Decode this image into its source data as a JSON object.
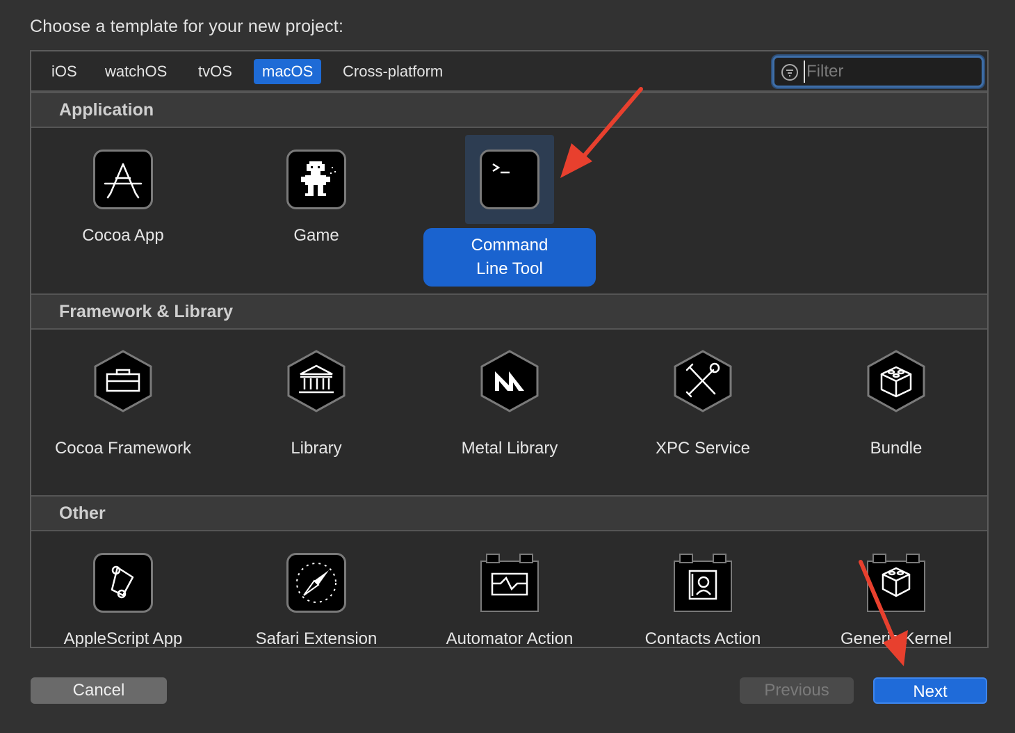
{
  "prompt": "Choose a template for your new project:",
  "tabs": [
    {
      "label": "iOS",
      "active": false
    },
    {
      "label": "watchOS",
      "active": false
    },
    {
      "label": "tvOS",
      "active": false
    },
    {
      "label": "macOS",
      "active": true
    },
    {
      "label": "Cross-platform",
      "active": false
    }
  ],
  "filter": {
    "placeholder": "Filter",
    "value": ""
  },
  "sections": {
    "application": {
      "title": "Application",
      "items": [
        {
          "label": "Cocoa App",
          "icon": "app-store-icon"
        },
        {
          "label": "Game",
          "icon": "game-sprite-icon"
        },
        {
          "label": "Command Line Tool",
          "line1": "Command",
          "line2": "Line Tool",
          "icon": "terminal-icon",
          "selected": true
        }
      ]
    },
    "framework": {
      "title": "Framework & Library",
      "items": [
        {
          "label": "Cocoa Framework",
          "icon": "toolbox-icon"
        },
        {
          "label": "Library",
          "icon": "library-building-icon"
        },
        {
          "label": "Metal Library",
          "icon": "metal-icon"
        },
        {
          "label": "XPC Service",
          "icon": "tools-icon"
        },
        {
          "label": "Bundle",
          "icon": "lego-brick-icon"
        }
      ]
    },
    "other": {
      "title": "Other",
      "items": [
        {
          "label": "AppleScript App",
          "icon": "applescript-icon"
        },
        {
          "label": "Safari Extension",
          "icon": "compass-icon"
        },
        {
          "label": "Automator Action",
          "icon": "automator-icon"
        },
        {
          "label": "Contacts Action",
          "icon": "contacts-icon"
        },
        {
          "label": "Generic Kernel",
          "icon": "kernel-icon"
        }
      ]
    }
  },
  "buttons": {
    "cancel": "Cancel",
    "previous": "Previous",
    "next": "Next"
  },
  "colors": {
    "accent": "#1e6bd6",
    "annotation_arrow": "#e8402e"
  }
}
